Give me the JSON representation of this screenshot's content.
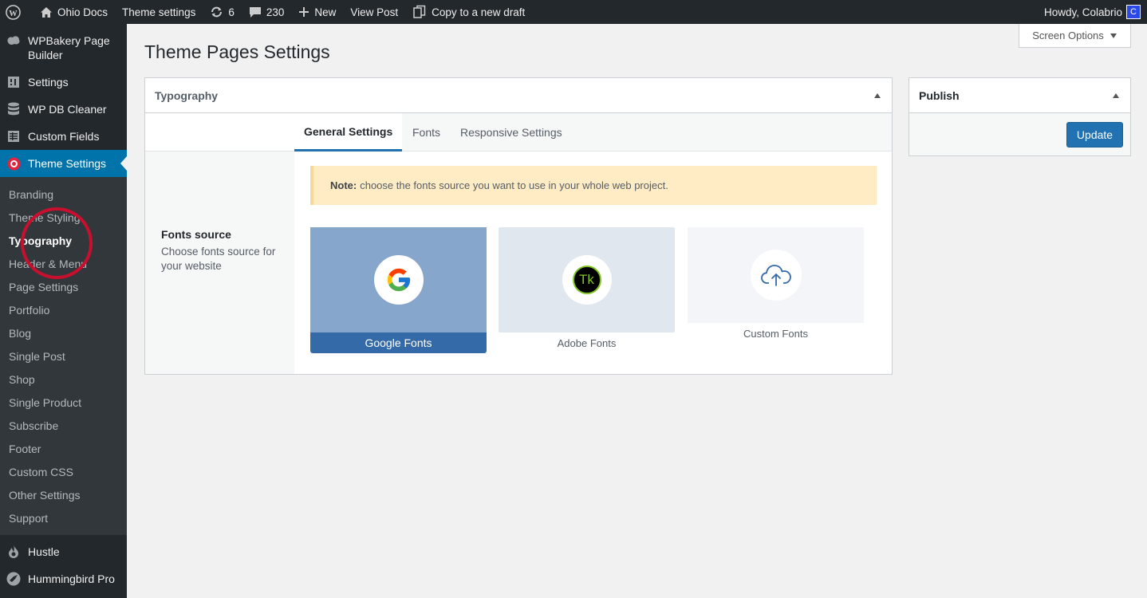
{
  "adminbar": {
    "site_name": "Ohio Docs",
    "theme_settings": "Theme settings",
    "updates_count": "6",
    "comments_count": "230",
    "new_label": "New",
    "view_post": "View Post",
    "copy_draft": "Copy to a new draft",
    "howdy": "Howdy, Colabrio",
    "avatar_letter": "C"
  },
  "sidebar": {
    "items": [
      {
        "label": "WPBakery Page Builder",
        "icon": "wpbakery-icon"
      },
      {
        "label": "Settings",
        "icon": "settings-icon"
      },
      {
        "label": "WP DB Cleaner",
        "icon": "database-icon"
      },
      {
        "label": "Custom Fields",
        "icon": "custom-fields-icon"
      },
      {
        "label": "Theme Settings",
        "icon": "theme-settings-icon"
      },
      {
        "label": "Hustle",
        "icon": "hustle-icon"
      },
      {
        "label": "Hummingbird Pro",
        "icon": "hummingbird-icon"
      }
    ],
    "submenu": [
      "Branding",
      "Theme Styling",
      "Typography",
      "Header & Menu",
      "Page Settings",
      "Portfolio",
      "Blog",
      "Single Post",
      "Shop",
      "Single Product",
      "Subscribe",
      "Footer",
      "Custom CSS",
      "Other Settings",
      "Support"
    ]
  },
  "screen_options": "Screen Options",
  "page_title": "Theme Pages Settings",
  "typography_panel": {
    "title": "Typography",
    "tabs": [
      "General Settings",
      "Fonts",
      "Responsive Settings"
    ],
    "fonts_source": {
      "title": "Fonts source",
      "description": "Choose fonts source for your website"
    },
    "note": {
      "label": "Note:",
      "text": "choose the fonts source you want to use in your whole web project."
    },
    "cards": [
      "Google Fonts",
      "Adobe Fonts",
      "Custom Fonts"
    ],
    "adobe_badge": "Tk"
  },
  "publish_panel": {
    "title": "Publish",
    "update_label": "Update"
  },
  "colors": {
    "adminbar_bg": "#23282d",
    "submenu_bg": "#32373c",
    "accent": "#0073aa",
    "button": "#2271b1",
    "google_card": "#87a6cb",
    "google_label": "#356aa9",
    "note_bg": "#ffecc4",
    "highlight_circle": "#c8102e"
  }
}
